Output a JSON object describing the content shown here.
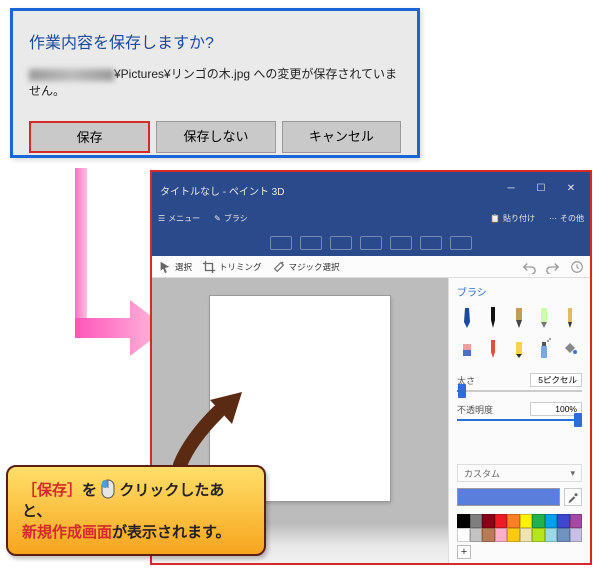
{
  "dialog": {
    "title": "作業内容を保存しますか?",
    "message_suffix": "¥Pictures¥リンゴの木.jpg への変更が保存されていません。",
    "save": "保存",
    "dont_save": "保存しない",
    "cancel": "キャンセル"
  },
  "paint3d": {
    "title": "タイトルなし - ペイント 3D",
    "menu": {
      "menu": "メニュー",
      "brush_tab": "ブラシ",
      "paste_group": "貼り付け",
      "etc": "その他"
    },
    "toolbar": {
      "select": "選択",
      "trimming": "トリミング",
      "magic": "マジック選択"
    },
    "panel": {
      "title": "ブラシ",
      "thickness_label": "太さ",
      "thickness_value": "5ピクセル",
      "opacity_label": "不透明度",
      "opacity_value": "100%",
      "custom": "カスタム",
      "brushes": [
        "marker",
        "calligraphy",
        "oil",
        "watercolor",
        "pencil",
        "eraser",
        "crayon",
        "pixel",
        "spray",
        "fill"
      ]
    },
    "palette": {
      "row1": [
        "#000000",
        "#7f7f7f",
        "#880015",
        "#ed1c24",
        "#ff7f27",
        "#fff200",
        "#22b14c",
        "#00a2e8",
        "#3f48cc",
        "#a349a4"
      ],
      "row2": [
        "#ffffff",
        "#c3c3c3",
        "#b97a57",
        "#ffaec9",
        "#ffc90e",
        "#efe4b0",
        "#b5e61d",
        "#99d9ea",
        "#7092be",
        "#c8bfe7"
      ]
    }
  },
  "callout": {
    "line1_red": "［保存］",
    "line1_b": "を",
    "line1_c": "クリック",
    "line1_d": "したあと、",
    "line2_red": "新規作成画面",
    "line2": "が表示されます。"
  }
}
